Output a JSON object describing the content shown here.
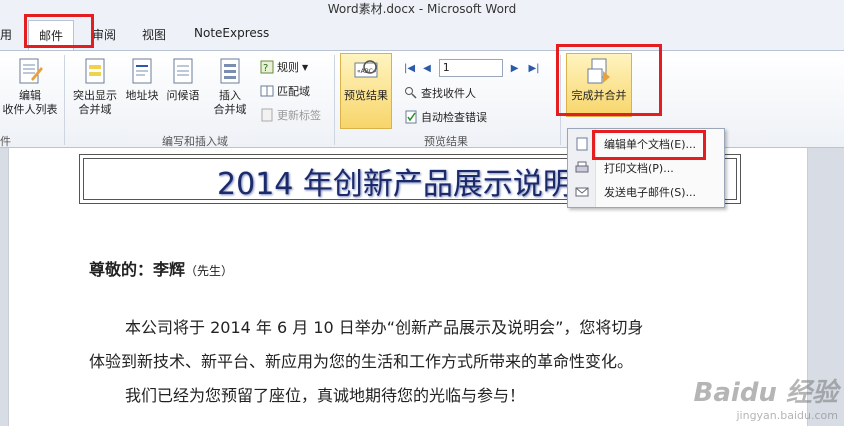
{
  "window": {
    "title": "Word素材.docx - Microsoft Word"
  },
  "tabs": [
    {
      "label": "用"
    },
    {
      "label": "邮件"
    },
    {
      "label": "审阅"
    },
    {
      "label": "视图"
    },
    {
      "label": "NoteExpress"
    }
  ],
  "ribbon": {
    "edit_recipients": "编辑\n收件人列表",
    "group1_label": "件",
    "highlight_fields": "突出显示\n合并域",
    "address_block": "地址块",
    "greeting_line": "问候语",
    "insert_field": "插入\n合并域",
    "rules": "规则",
    "match_fields": "匹配域",
    "update_labels": "更新标签",
    "group2_label": "编写和插入域",
    "preview_results": "预览结果",
    "record_number": "1",
    "find_recipient": "查找收件人",
    "auto_check": "自动检查错误",
    "group3_label": "预览结果",
    "finish_merge": "完成并合并"
  },
  "dropdown": {
    "items": [
      {
        "label": "编辑单个文档(E)..."
      },
      {
        "label": "打印文档(P)..."
      },
      {
        "label": "发送电子邮件(S)..."
      }
    ]
  },
  "document": {
    "title": "2014 年创新产品展示说明会",
    "greeting_prefix": "尊敬的：李辉",
    "greeting_suffix": "（先生）",
    "paragraph1_line1": "本公司将于 2014 年 6 月 10 日举办“创新产品展示及说明会”，您将切身",
    "paragraph1_line2": "体验到新技术、新平台、新应用为您的生活和工作方式所带来的革命性变化。",
    "paragraph2": "我们已经为您预留了座位，真诚地期待您的光临与参与！"
  },
  "watermark": {
    "line1": "Baidu 经验",
    "line2": "jingyan.baidu.com"
  },
  "colors": {
    "highlight_box": "#e41e1e",
    "title_text": "#1b2a6b",
    "active_button": "#f7d56a"
  }
}
